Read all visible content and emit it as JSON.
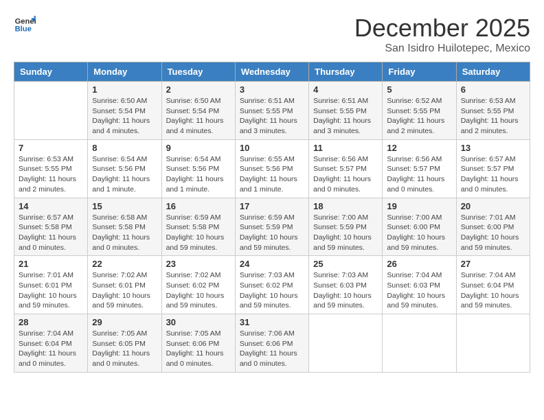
{
  "logo": {
    "line1": "General",
    "line2": "Blue"
  },
  "title": "December 2025",
  "location": "San Isidro Huilotepec, Mexico",
  "days_of_week": [
    "Sunday",
    "Monday",
    "Tuesday",
    "Wednesday",
    "Thursday",
    "Friday",
    "Saturday"
  ],
  "weeks": [
    [
      {
        "day": "",
        "info": ""
      },
      {
        "day": "1",
        "info": "Sunrise: 6:50 AM\nSunset: 5:54 PM\nDaylight: 11 hours\nand 4 minutes."
      },
      {
        "day": "2",
        "info": "Sunrise: 6:50 AM\nSunset: 5:54 PM\nDaylight: 11 hours\nand 4 minutes."
      },
      {
        "day": "3",
        "info": "Sunrise: 6:51 AM\nSunset: 5:55 PM\nDaylight: 11 hours\nand 3 minutes."
      },
      {
        "day": "4",
        "info": "Sunrise: 6:51 AM\nSunset: 5:55 PM\nDaylight: 11 hours\nand 3 minutes."
      },
      {
        "day": "5",
        "info": "Sunrise: 6:52 AM\nSunset: 5:55 PM\nDaylight: 11 hours\nand 2 minutes."
      },
      {
        "day": "6",
        "info": "Sunrise: 6:53 AM\nSunset: 5:55 PM\nDaylight: 11 hours\nand 2 minutes."
      }
    ],
    [
      {
        "day": "7",
        "info": "Sunrise: 6:53 AM\nSunset: 5:55 PM\nDaylight: 11 hours\nand 2 minutes."
      },
      {
        "day": "8",
        "info": "Sunrise: 6:54 AM\nSunset: 5:56 PM\nDaylight: 11 hours\nand 1 minute."
      },
      {
        "day": "9",
        "info": "Sunrise: 6:54 AM\nSunset: 5:56 PM\nDaylight: 11 hours\nand 1 minute."
      },
      {
        "day": "10",
        "info": "Sunrise: 6:55 AM\nSunset: 5:56 PM\nDaylight: 11 hours\nand 1 minute."
      },
      {
        "day": "11",
        "info": "Sunrise: 6:56 AM\nSunset: 5:57 PM\nDaylight: 11 hours\nand 0 minutes."
      },
      {
        "day": "12",
        "info": "Sunrise: 6:56 AM\nSunset: 5:57 PM\nDaylight: 11 hours\nand 0 minutes."
      },
      {
        "day": "13",
        "info": "Sunrise: 6:57 AM\nSunset: 5:57 PM\nDaylight: 11 hours\nand 0 minutes."
      }
    ],
    [
      {
        "day": "14",
        "info": "Sunrise: 6:57 AM\nSunset: 5:58 PM\nDaylight: 11 hours\nand 0 minutes."
      },
      {
        "day": "15",
        "info": "Sunrise: 6:58 AM\nSunset: 5:58 PM\nDaylight: 11 hours\nand 0 minutes."
      },
      {
        "day": "16",
        "info": "Sunrise: 6:59 AM\nSunset: 5:58 PM\nDaylight: 10 hours\nand 59 minutes."
      },
      {
        "day": "17",
        "info": "Sunrise: 6:59 AM\nSunset: 5:59 PM\nDaylight: 10 hours\nand 59 minutes."
      },
      {
        "day": "18",
        "info": "Sunrise: 7:00 AM\nSunset: 5:59 PM\nDaylight: 10 hours\nand 59 minutes."
      },
      {
        "day": "19",
        "info": "Sunrise: 7:00 AM\nSunset: 6:00 PM\nDaylight: 10 hours\nand 59 minutes."
      },
      {
        "day": "20",
        "info": "Sunrise: 7:01 AM\nSunset: 6:00 PM\nDaylight: 10 hours\nand 59 minutes."
      }
    ],
    [
      {
        "day": "21",
        "info": "Sunrise: 7:01 AM\nSunset: 6:01 PM\nDaylight: 10 hours\nand 59 minutes."
      },
      {
        "day": "22",
        "info": "Sunrise: 7:02 AM\nSunset: 6:01 PM\nDaylight: 10 hours\nand 59 minutes."
      },
      {
        "day": "23",
        "info": "Sunrise: 7:02 AM\nSunset: 6:02 PM\nDaylight: 10 hours\nand 59 minutes."
      },
      {
        "day": "24",
        "info": "Sunrise: 7:03 AM\nSunset: 6:02 PM\nDaylight: 10 hours\nand 59 minutes."
      },
      {
        "day": "25",
        "info": "Sunrise: 7:03 AM\nSunset: 6:03 PM\nDaylight: 10 hours\nand 59 minutes."
      },
      {
        "day": "26",
        "info": "Sunrise: 7:04 AM\nSunset: 6:03 PM\nDaylight: 10 hours\nand 59 minutes."
      },
      {
        "day": "27",
        "info": "Sunrise: 7:04 AM\nSunset: 6:04 PM\nDaylight: 10 hours\nand 59 minutes."
      }
    ],
    [
      {
        "day": "28",
        "info": "Sunrise: 7:04 AM\nSunset: 6:04 PM\nDaylight: 11 hours\nand 0 minutes."
      },
      {
        "day": "29",
        "info": "Sunrise: 7:05 AM\nSunset: 6:05 PM\nDaylight: 11 hours\nand 0 minutes."
      },
      {
        "day": "30",
        "info": "Sunrise: 7:05 AM\nSunset: 6:06 PM\nDaylight: 11 hours\nand 0 minutes."
      },
      {
        "day": "31",
        "info": "Sunrise: 7:06 AM\nSunset: 6:06 PM\nDaylight: 11 hours\nand 0 minutes."
      },
      {
        "day": "",
        "info": ""
      },
      {
        "day": "",
        "info": ""
      },
      {
        "day": "",
        "info": ""
      }
    ]
  ]
}
